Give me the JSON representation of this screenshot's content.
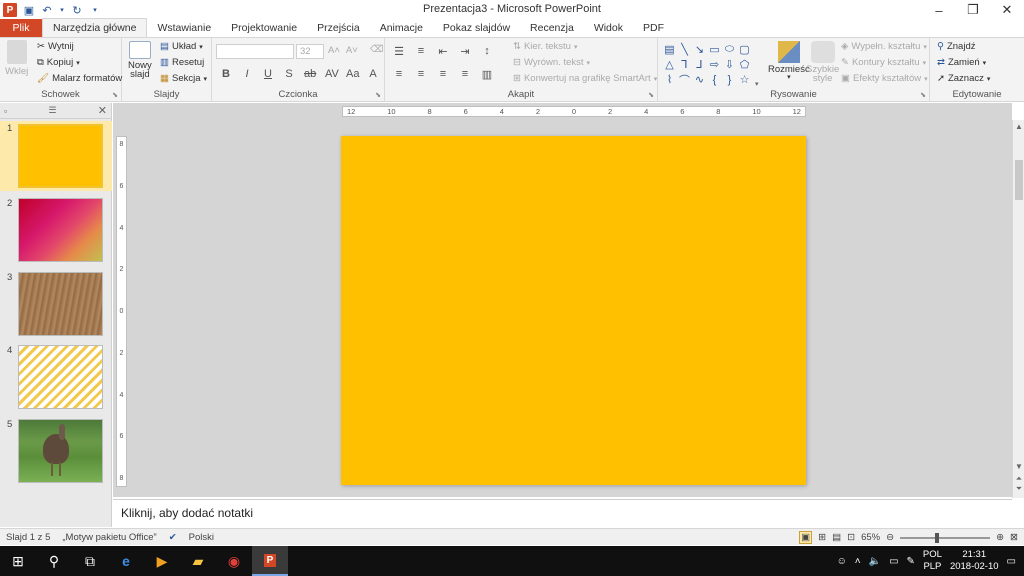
{
  "window": {
    "title": "Prezentacja3 - Microsoft PowerPoint",
    "controls": [
      "–",
      "❐",
      "✕"
    ]
  },
  "tabs": [
    "Plik",
    "Narzędzia główne",
    "Wstawianie",
    "Projektowanie",
    "Przejścia",
    "Animacje",
    "Pokaz slajdów",
    "Recenzja",
    "Widok",
    "PDF"
  ],
  "active_tab": "Narzędzia główne",
  "ribbon": {
    "schowek": {
      "label": "Schowek",
      "paste": "Wklej",
      "cut": "Wytnij",
      "copy": "Kopiuj",
      "painter": "Malarz formatów"
    },
    "slajdy": {
      "label": "Slajdy",
      "new_slide_1": "Nowy",
      "new_slide_2": "slajd",
      "layout": "Układ",
      "reset": "Resetuj",
      "section": "Sekcja"
    },
    "czcionka": {
      "label": "Czcionka",
      "font_size": "32"
    },
    "akapit": {
      "label": "Akapit",
      "text_direction": "Kier. tekstu",
      "align_text": "Wyrówn. tekst",
      "smartart": "Konwertuj na grafikę SmartArt"
    },
    "rysowanie": {
      "label": "Rysowanie",
      "arrange": "Rozmieść",
      "quick_styles_1": "Szybkie",
      "quick_styles_2": "style",
      "fill": "Wypełn. kształtu",
      "outline": "Kontury kształtu",
      "effects": "Efekty kształtów"
    },
    "edytowanie": {
      "label": "Edytowanie",
      "find": "Znajdź",
      "replace": "Zamień",
      "select": "Zaznacz"
    }
  },
  "slides": [
    {
      "num": "1",
      "style": "yellow"
    },
    {
      "num": "2",
      "style": "gradient"
    },
    {
      "num": "3",
      "style": "wood"
    },
    {
      "num": "4",
      "style": "stripes"
    },
    {
      "num": "5",
      "style": "photo"
    }
  ],
  "rulers": {
    "horizontal": [
      "12",
      "10",
      "8",
      "6",
      "4",
      "2",
      "0",
      "2",
      "4",
      "6",
      "8",
      "10",
      "12"
    ],
    "vertical": [
      "8",
      "6",
      "4",
      "2",
      "0",
      "2",
      "4",
      "6",
      "8"
    ]
  },
  "slide_color": "#ffc000",
  "notes_placeholder": "Kliknij, aby dodać notatki",
  "status": {
    "slide": "Slajd 1 z 5",
    "theme": "„Motyw pakietu Office”",
    "language": "Polski",
    "zoom": "65%"
  },
  "tray": {
    "lang_1": "POL",
    "lang_2": "PLP",
    "time": "21:31",
    "date": "2018-02-10"
  }
}
